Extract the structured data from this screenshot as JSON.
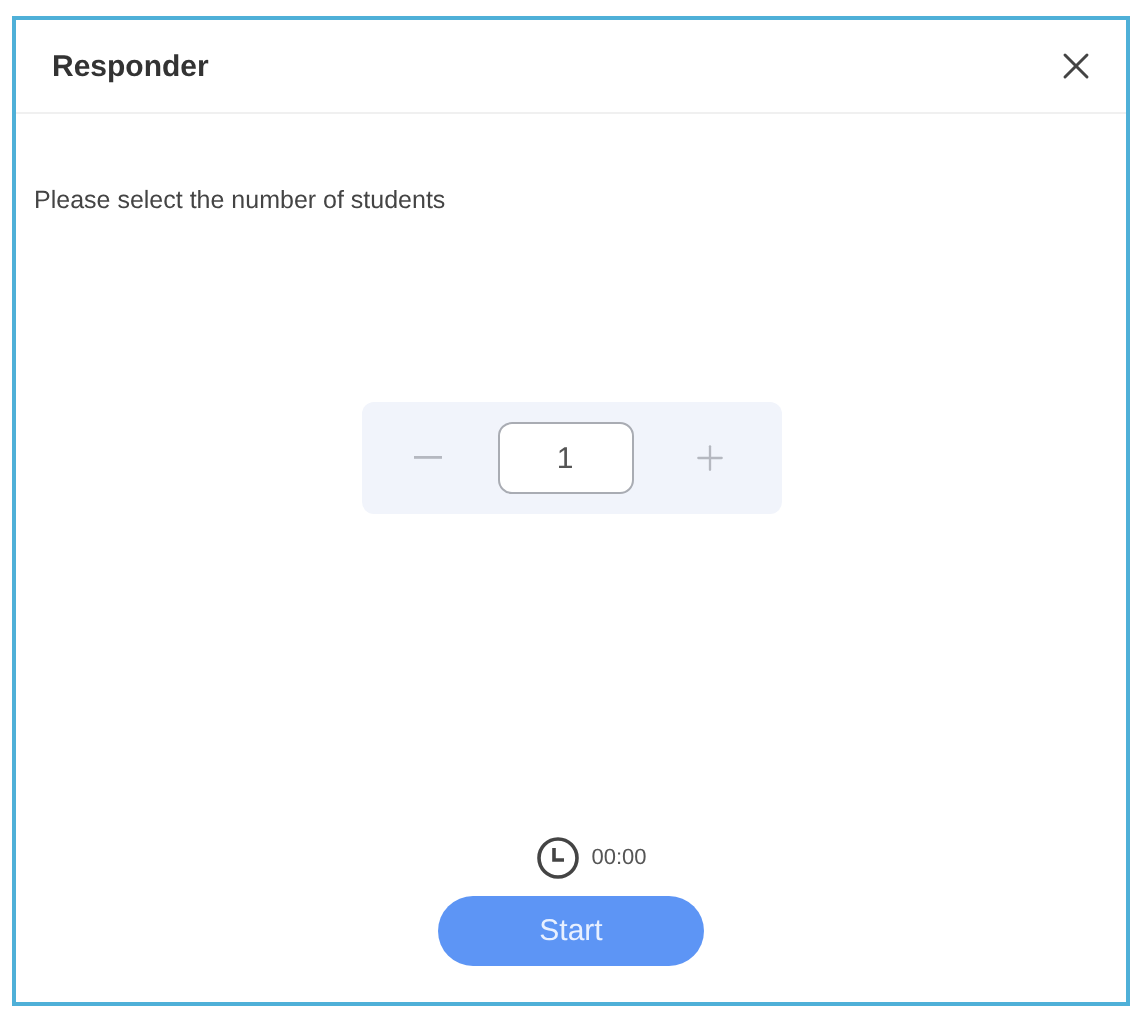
{
  "window": {
    "title": "Responder"
  },
  "prompt": "Please select the number of students",
  "stepper": {
    "value": "1"
  },
  "timer": "00:00",
  "buttons": [
    "Start"
  ]
}
